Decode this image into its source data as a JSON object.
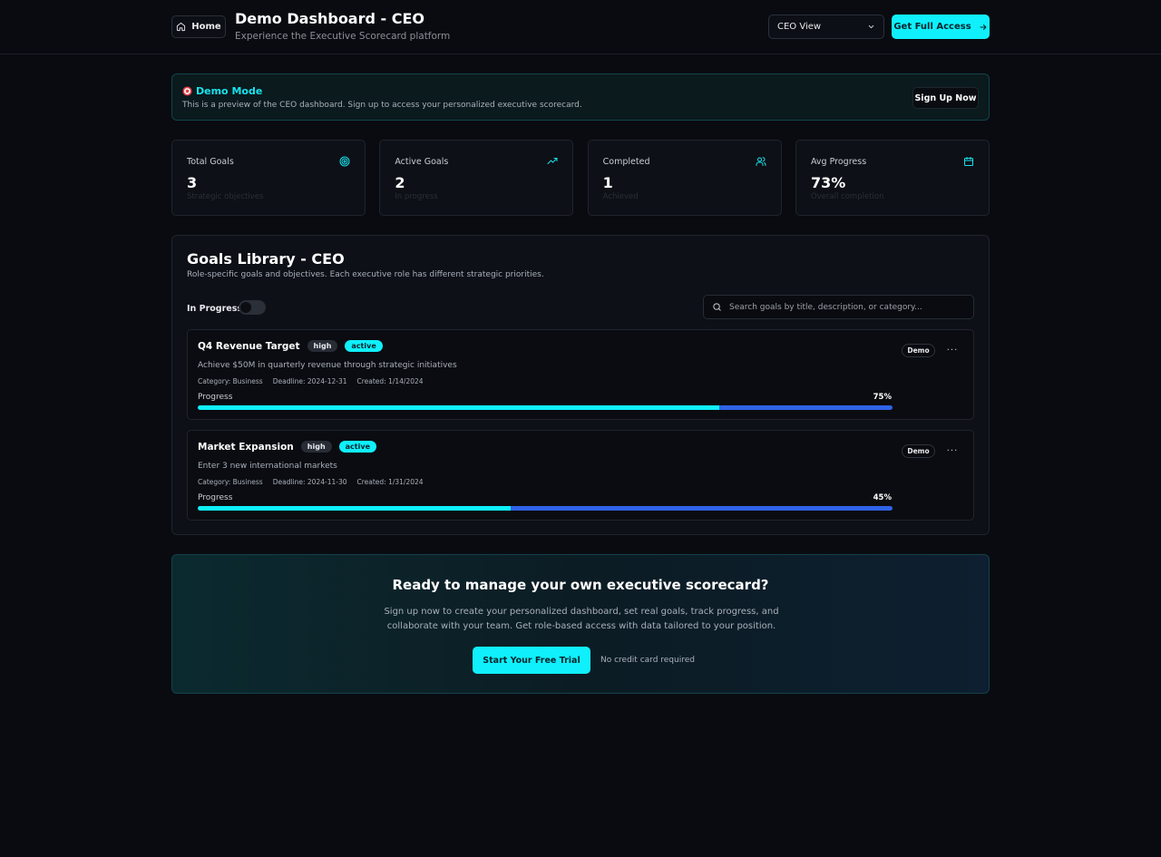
{
  "header": {
    "home_label": "Home",
    "title": "Demo Dashboard - CEO",
    "subtitle": "Experience the Executive Scorecard platform",
    "view_select": "CEO View",
    "access_label": "Get Full Access"
  },
  "banner": {
    "icon": "target-emoji",
    "title": "Demo Mode",
    "text": "This is a preview of the CEO dashboard. Sign up to access your personalized executive scorecard.",
    "signup_label": "Sign Up Now"
  },
  "stats": [
    {
      "label": "Total Goals",
      "value": "3",
      "desc": "Strategic objectives",
      "icon": "target-icon"
    },
    {
      "label": "Active Goals",
      "value": "2",
      "desc": "In progress",
      "icon": "trending-up-icon"
    },
    {
      "label": "Completed",
      "value": "1",
      "desc": "Achieved",
      "icon": "users-icon"
    },
    {
      "label": "Avg Progress",
      "value": "73%",
      "desc": "Overall completion",
      "icon": "calendar-icon"
    }
  ],
  "library": {
    "title": "Goals Library - CEO",
    "desc": "Role-specific goals and objectives. Each executive role has different strategic priorities.",
    "filter_label": "In Progress",
    "search_placeholder": "Search goals by title, description, or category..."
  },
  "goals": [
    {
      "title": "Q4 Revenue Target",
      "priority": "high",
      "status": "active",
      "desc": "Achieve $50M in quarterly revenue through strategic initiatives",
      "category": "Category: Business",
      "deadline": "Deadline: 2024-12-31",
      "created": "Created: 1/14/2024",
      "progress_label": "Progress",
      "progress_text": "75%",
      "progress": 75,
      "badge": "Demo",
      "more": "···"
    },
    {
      "title": "Market Expansion",
      "priority": "high",
      "status": "active",
      "desc": "Enter 3 new international markets",
      "category": "Category: Business",
      "deadline": "Deadline: 2024-11-30",
      "created": "Created: 1/31/2024",
      "progress_label": "Progress",
      "progress_text": "45%",
      "progress": 45,
      "badge": "Demo",
      "more": "···"
    }
  ],
  "cta": {
    "title": "Ready to manage your own executive scorecard?",
    "text": "Sign up now to create your personalized dashboard, set real goals, track progress, and collaborate with your team. Get role-based access with data tailored to your position.",
    "button_label": "Start Your Free Trial",
    "note": "No credit card required"
  },
  "colors": {
    "accent": "#0ff0fc",
    "progress_track": "#2f63e8",
    "background": "#090b10"
  }
}
